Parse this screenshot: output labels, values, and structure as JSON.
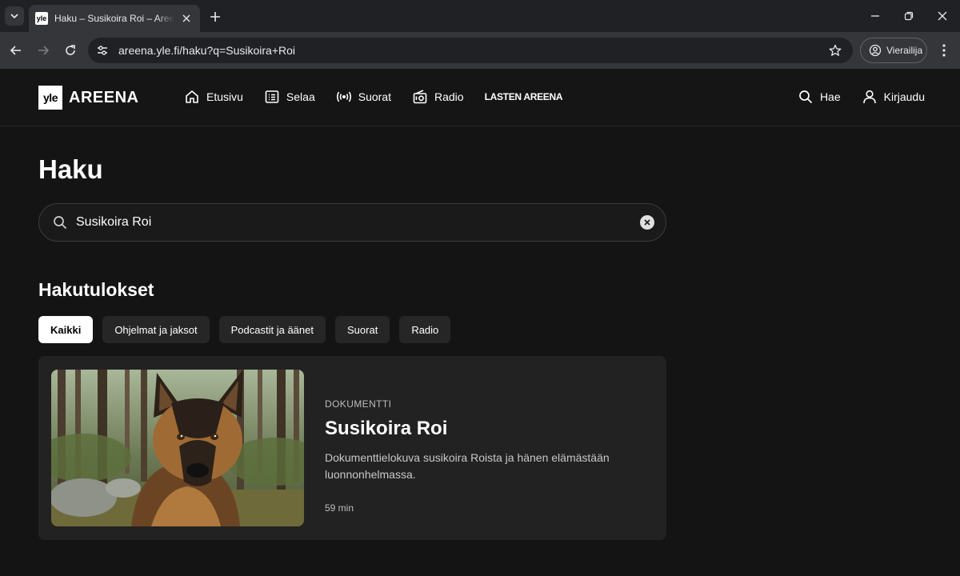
{
  "browser": {
    "tab_title": "Haku – Susikoira Roi – Areena – Yle",
    "favicon_text": "yle",
    "url": "areena.yle.fi/haku?q=Susikoira+Roi",
    "profile_label": "Vierailija"
  },
  "site": {
    "logo_box": "yle",
    "logo_text": "AREENA",
    "nav": [
      {
        "label": "Etusivu",
        "icon": "home-icon"
      },
      {
        "label": "Selaa",
        "icon": "list-icon"
      },
      {
        "label": "Suorat",
        "icon": "broadcast-icon"
      },
      {
        "label": "Radio",
        "icon": "radio-icon"
      },
      {
        "label": "LASTEN AREENA"
      }
    ],
    "right_nav": [
      {
        "label": "Hae",
        "icon": "search-icon"
      },
      {
        "label": "Kirjaudu",
        "icon": "user-icon"
      }
    ]
  },
  "main": {
    "page_title": "Haku",
    "search_value": "Susikoira Roi",
    "results_title": "Hakutulokset",
    "filters": [
      "Kaikki",
      "Ohjelmat ja jaksot",
      "Podcastit ja äänet",
      "Suorat",
      "Radio"
    ],
    "active_filter": "Kaikki",
    "result": {
      "category": "DOKUMENTTI",
      "title": "Susikoira Roi",
      "description": "Dokumenttielokuva susikoira Roista ja hänen elämästään luonnonhelmassa.",
      "duration": "59 min",
      "image": "german-shepherd-in-forest"
    }
  }
}
